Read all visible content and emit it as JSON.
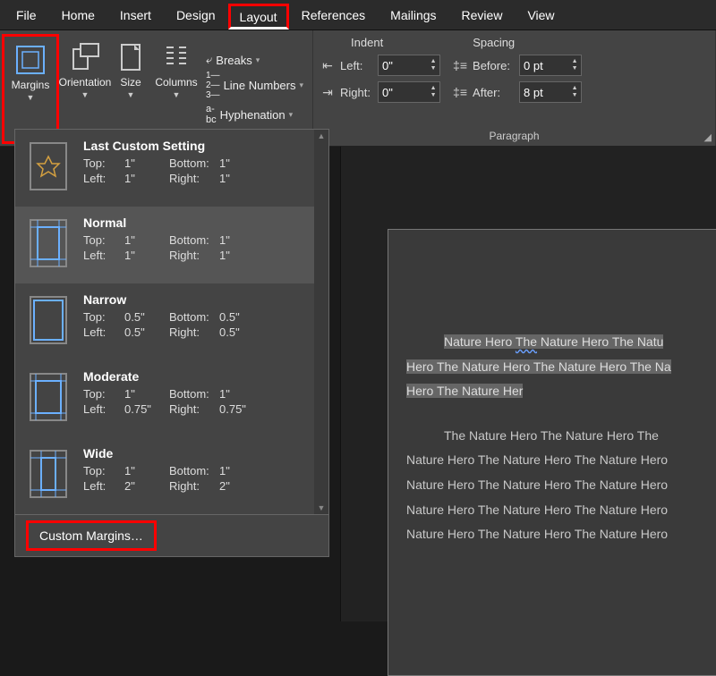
{
  "tabs": {
    "file": "File",
    "home": "Home",
    "insert": "Insert",
    "design": "Design",
    "layout": "Layout",
    "references": "References",
    "mailings": "Mailings",
    "review": "Review",
    "view": "View"
  },
  "ribbon": {
    "page_setup": {
      "margins": "Margins",
      "orientation": "Orientation",
      "size": "Size",
      "columns": "Columns",
      "breaks": "Breaks",
      "line_numbers": "Line Numbers",
      "hyphenation": "Hyphenation"
    },
    "paragraph": {
      "indent_label": "Indent",
      "spacing_label": "Spacing",
      "left_label": "Left:",
      "right_label": "Right:",
      "before_label": "Before:",
      "after_label": "After:",
      "left_val": "0\"",
      "right_val": "0\"",
      "before_val": "0 pt",
      "after_val": "8 pt",
      "group_label": "Paragraph"
    }
  },
  "dropdown": {
    "items": [
      {
        "name": "Last Custom Setting",
        "top": "1\"",
        "bottom": "1\"",
        "left": "1\"",
        "right": "1\""
      },
      {
        "name": "Normal",
        "top": "1\"",
        "bottom": "1\"",
        "left": "1\"",
        "right": "1\""
      },
      {
        "name": "Narrow",
        "top": "0.5\"",
        "bottom": "0.5\"",
        "left": "0.5\"",
        "right": "0.5\""
      },
      {
        "name": "Moderate",
        "top": "1\"",
        "bottom": "1\"",
        "left": "0.75\"",
        "right": "0.75\""
      },
      {
        "name": "Wide",
        "top": "1\"",
        "bottom": "1\"",
        "left": "2\"",
        "right": "2\""
      }
    ],
    "labels": {
      "top": "Top:",
      "bottom": "Bottom:",
      "left": "Left:",
      "right": "Right:"
    },
    "custom": "Custom Margins…"
  },
  "document": {
    "lines": [
      "Nature Hero The Nature Hero The Natu",
      "Hero The Nature Hero The Nature Hero The Na",
      "Hero The Nature Her",
      "The Nature Hero The Nature Hero The ",
      "Nature Hero The Nature Hero The Nature Hero",
      "Nature Hero The Nature Hero The Nature Hero",
      "Nature Hero The Nature Hero The Nature Hero",
      "Nature Hero The Nature Hero The Nature Hero"
    ]
  }
}
